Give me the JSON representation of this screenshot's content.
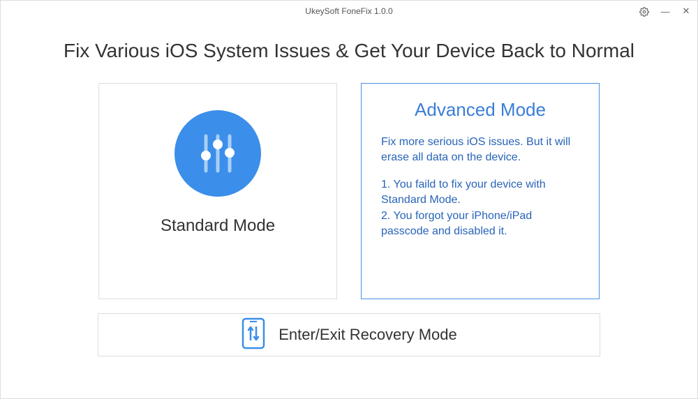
{
  "titlebar": {
    "title": "UkeySoft FoneFix 1.0.0"
  },
  "heading": "Fix Various iOS System Issues & Get Your Device Back to Normal",
  "standard": {
    "title": "Standard Mode"
  },
  "advanced": {
    "title": "Advanced Mode",
    "desc": "Fix more serious iOS issues. But it will erase all data on the device.",
    "item1": "1. You faild to fix your device with Standard Mode.",
    "item2": "2. You forgot your iPhone/iPad passcode and disabled it."
  },
  "recovery": {
    "label": "Enter/Exit Recovery Mode"
  }
}
